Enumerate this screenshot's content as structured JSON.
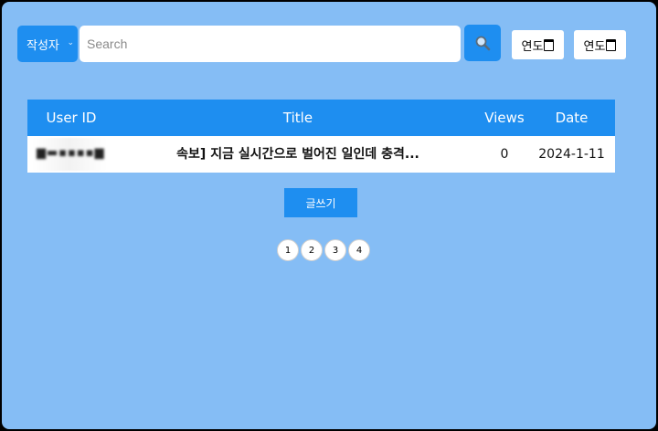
{
  "search": {
    "filter_label": "작성자",
    "placeholder": "Search",
    "value": "",
    "search_icon": "magnifier-icon"
  },
  "date_filters": [
    {
      "label": "연도",
      "icon": "calendar-icon"
    },
    {
      "label": "연도",
      "icon": "calendar-icon"
    }
  ],
  "table": {
    "headers": [
      "User ID",
      "Title",
      "Views",
      "Date"
    ],
    "rows": [
      {
        "user_id": "(blurred)",
        "title": "속보] 지금 실시간으로 벌어진 일인데 충격...",
        "views": "0",
        "date": "2024-1-11"
      }
    ]
  },
  "write_button": "글쓰기",
  "pagination": [
    "1",
    "2",
    "3",
    "4"
  ],
  "colors": {
    "background": "#85bdf5",
    "accent": "#1e8ef0"
  }
}
